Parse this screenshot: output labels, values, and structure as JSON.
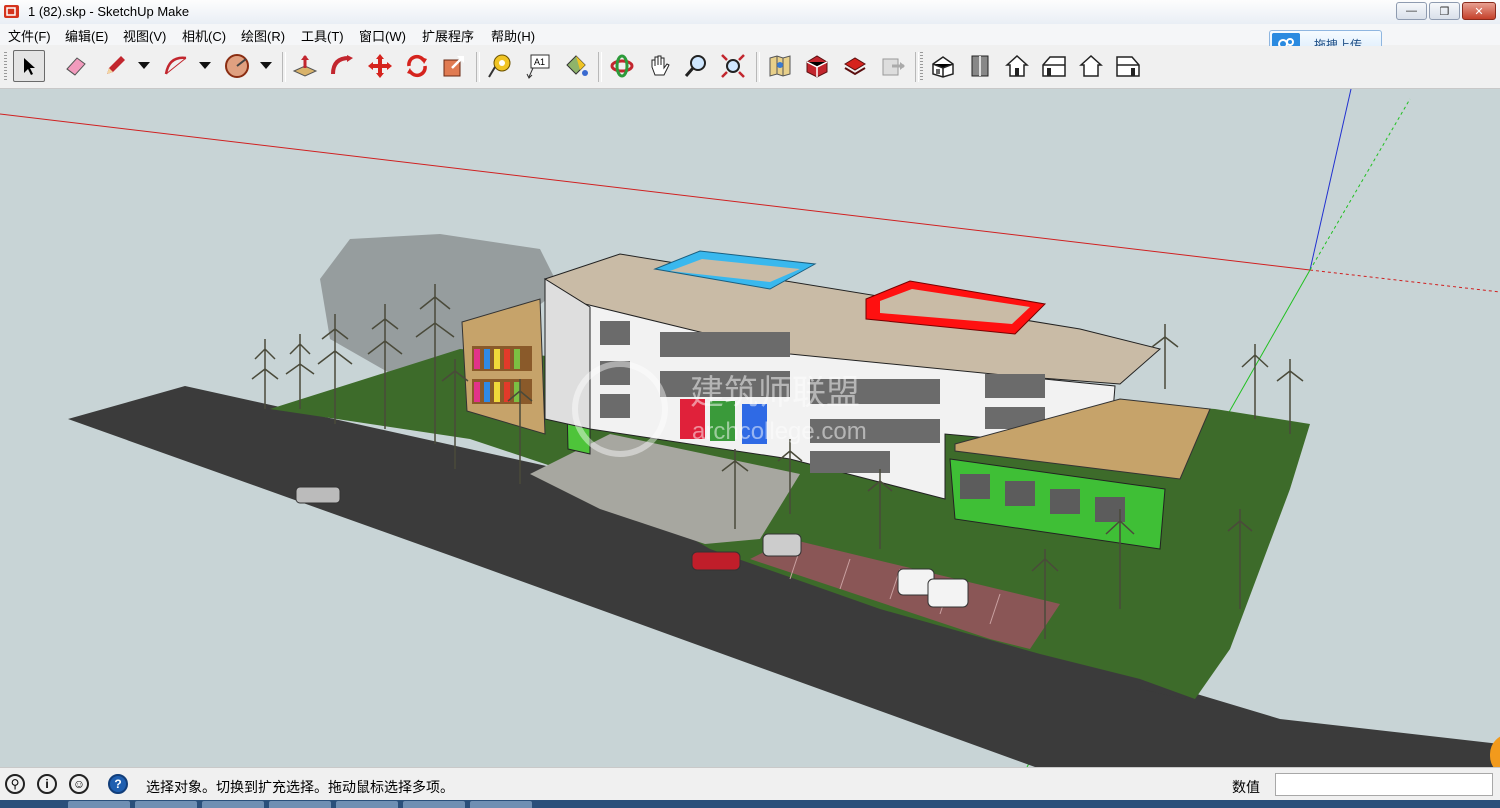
{
  "window": {
    "title": "1 (82).skp - SketchUp Make",
    "minimize_label": "—",
    "restore_label": "❐",
    "close_label": "✕"
  },
  "menu": {
    "items": [
      "文件(F)",
      "编辑(E)",
      "视图(V)",
      "相机(C)",
      "绘图(R)",
      "工具(T)",
      "窗口(W)",
      "扩展程序",
      "帮助(H)"
    ]
  },
  "upload": {
    "label": "拖拽上传"
  },
  "toolbar": {
    "tools": [
      {
        "icon": "select-arrow-icon",
        "active": true
      },
      {
        "icon": "eraser-icon"
      },
      {
        "icon": "pencil-line-icon",
        "dropdown": true
      },
      {
        "icon": "arc-icon",
        "dropdown": true
      },
      {
        "icon": "shape-polygon-icon",
        "dropdown": true
      },
      {
        "icon": "push-pull-icon"
      },
      {
        "icon": "follow-me-icon"
      },
      {
        "icon": "move-icon"
      },
      {
        "icon": "rotate-icon"
      },
      {
        "icon": "scale-icon"
      },
      {
        "icon": "tape-measure-icon"
      },
      {
        "icon": "text-label-icon"
      },
      {
        "icon": "paint-bucket-icon"
      },
      {
        "icon": "orbit-icon"
      },
      {
        "icon": "pan-hand-icon"
      },
      {
        "icon": "zoom-icon"
      },
      {
        "icon": "zoom-extents-icon"
      },
      {
        "icon": "3d-warehouse-icon"
      },
      {
        "icon": "extension-warehouse-icon"
      },
      {
        "icon": "layout-send-icon"
      },
      {
        "icon": "export-icon"
      },
      {
        "icon": "iso-view-icon"
      },
      {
        "icon": "top-view-icon"
      },
      {
        "icon": "front-view-icon"
      },
      {
        "icon": "right-view-icon"
      },
      {
        "icon": "back-view-icon"
      },
      {
        "icon": "left-view-icon"
      }
    ]
  },
  "watermark": {
    "line1": "建筑师联盟",
    "line2": "archcollege.com"
  },
  "statusbar": {
    "message": "选择对象。切换到扩充选择。拖动鼠标选择多项。",
    "measure_label": "数值",
    "measure_value": ""
  },
  "colors": {
    "sky": "#c8d4d6",
    "grass": "#3d6b2a",
    "road": "#3b3b3b",
    "red_axis": "#d02020",
    "green_axis": "#20c020",
    "blue_axis": "#2030d0",
    "roof_cyan": "#39b8ee",
    "roof_red": "#ff1010",
    "annex_green": "#3fbf36"
  }
}
